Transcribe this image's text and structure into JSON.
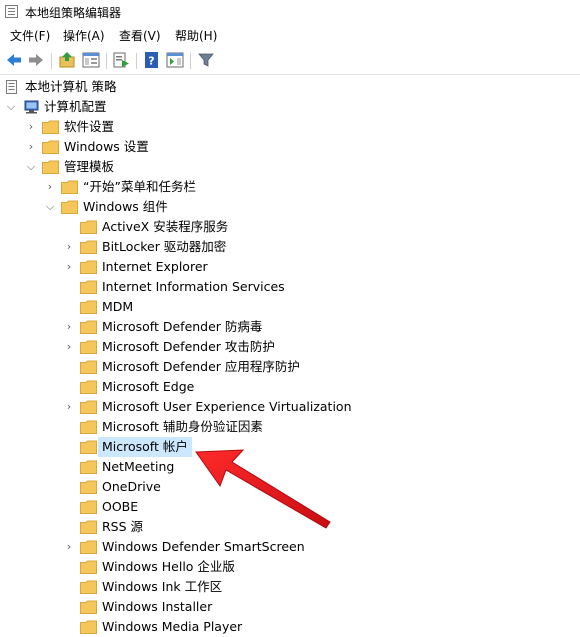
{
  "window": {
    "title": "本地组策略编辑器"
  },
  "menu": {
    "items": [
      "文件(F)",
      "操作(A)",
      "查看(V)",
      "帮助(H)"
    ]
  },
  "tree": {
    "root": "本地计算机 策略",
    "computer_config": "计算机配置",
    "software_settings": "软件设置",
    "windows_settings": "Windows 设置",
    "admin_templates": "管理模板",
    "start_menu": "“开始”菜单和任务栏",
    "windows_components": "Windows 组件",
    "components": [
      "ActiveX 安装程序服务",
      "BitLocker 驱动器加密",
      "Internet Explorer",
      "Internet Information Services",
      "MDM",
      "Microsoft Defender 防病毒",
      "Microsoft Defender 攻击防护",
      "Microsoft Defender 应用程序防护",
      "Microsoft Edge",
      "Microsoft User Experience Virtualization",
      "Microsoft 辅助身份验证因素",
      "Microsoft 帐户",
      "NetMeeting",
      "OneDrive",
      "OOBE",
      "RSS 源",
      "Windows Defender SmartScreen",
      "Windows Hello 企业版",
      "Windows Ink 工作区",
      "Windows Installer",
      "Windows Media Player"
    ]
  },
  "colors": {
    "selection": "#cce8ff",
    "folder": "#f5c65a",
    "arrow": "#e8151b"
  }
}
